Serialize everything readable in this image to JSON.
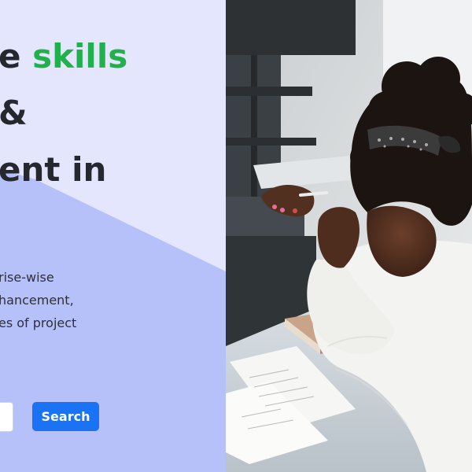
{
  "hero": {
    "headline_lines": [
      {
        "text": "e ",
        "accent": "skills"
      },
      {
        "text": "&"
      },
      {
        "text": "ent in"
      }
    ],
    "description_lines": [
      "rise-wise",
      "hancement,",
      "es of project"
    ],
    "search": {
      "button_label": "Search"
    },
    "colors": {
      "accent": "#21b14c",
      "button": "#1a73f5",
      "panel_bg": "#e4e6fd",
      "panel_shape": "#b6c0f9"
    }
  }
}
